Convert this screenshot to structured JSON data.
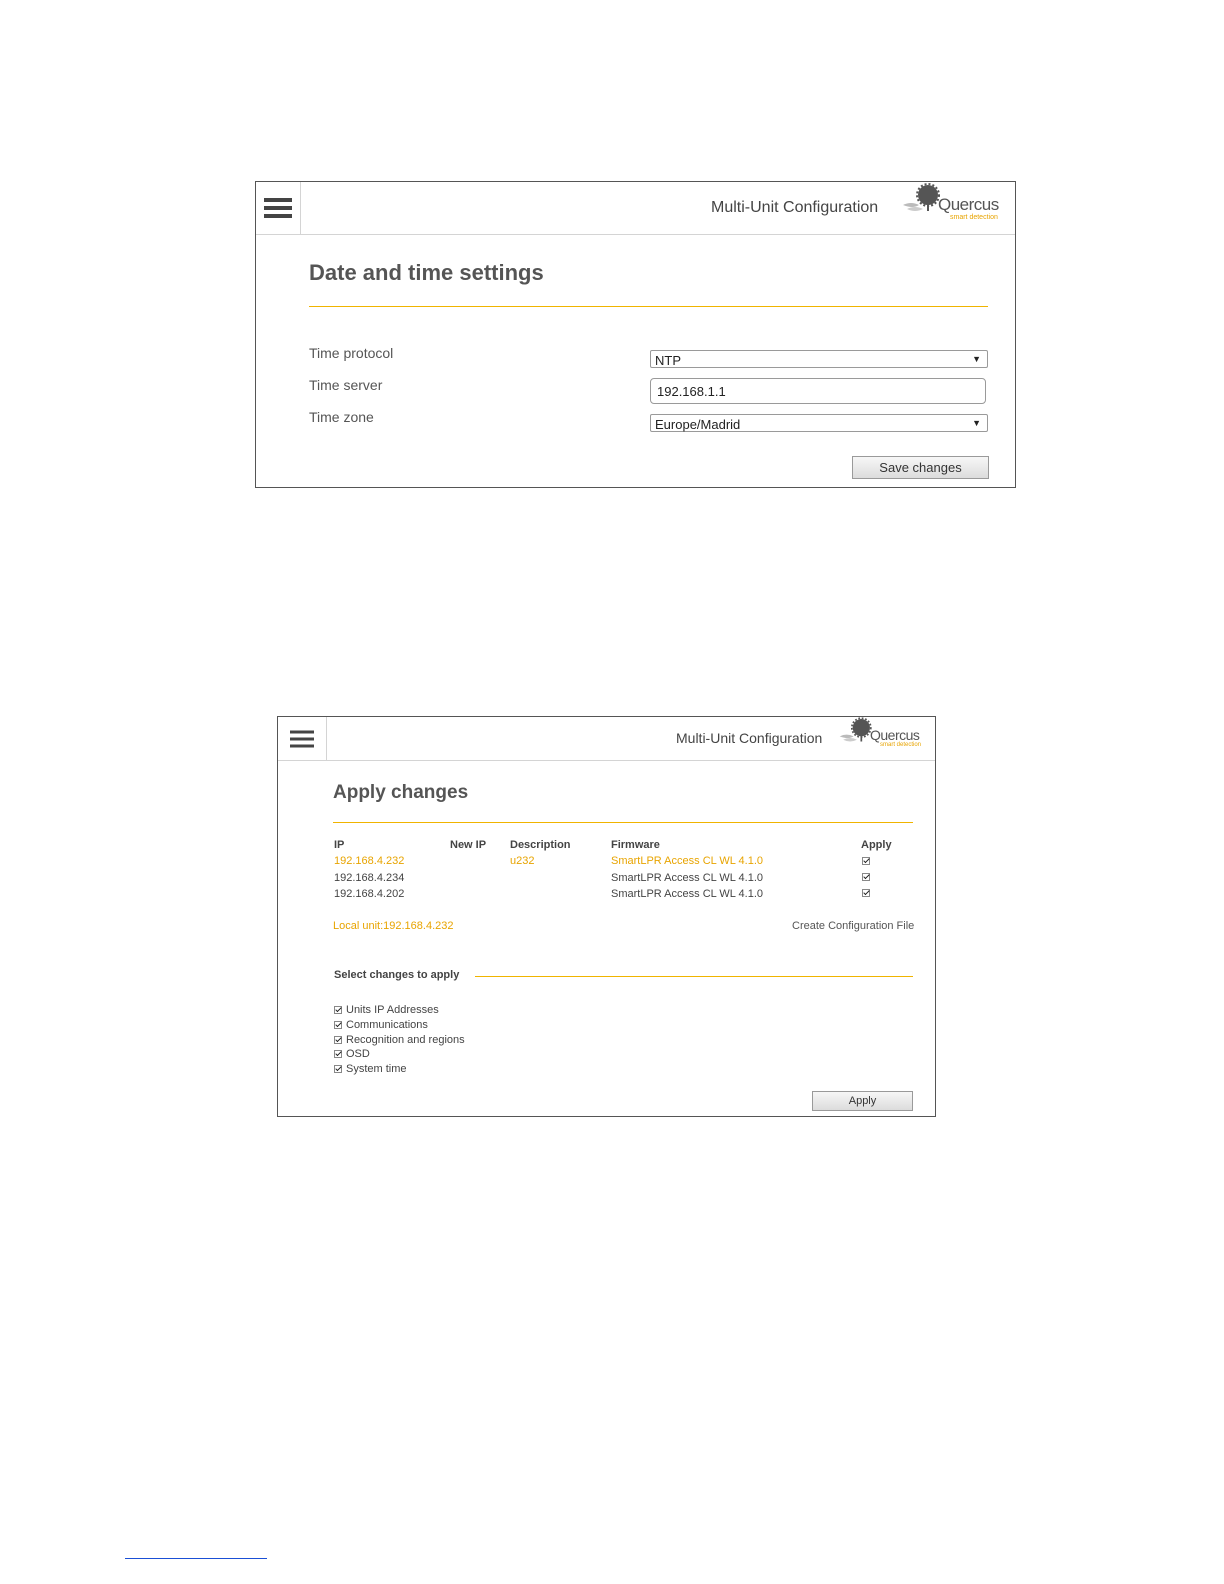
{
  "panel1": {
    "header": {
      "title": "Multi-Unit Configuration",
      "logo_name": "Quercus",
      "logo_tagline": "smart detection"
    },
    "page_title": "Date and time settings",
    "fields": [
      {
        "label": "Time protocol",
        "type": "select",
        "value": "NTP"
      },
      {
        "label": "Time server",
        "type": "text",
        "value": "192.168.1.1"
      },
      {
        "label": "Time zone",
        "type": "select",
        "value": "Europe/Madrid"
      }
    ],
    "save_label": "Save changes"
  },
  "panel2": {
    "header": {
      "title": "Multi-Unit Configuration",
      "logo_name": "Quercus",
      "logo_tagline": "smart detection"
    },
    "page_title": "Apply changes",
    "table": {
      "columns": [
        "IP",
        "New IP",
        "Description",
        "Firmware",
        "Apply"
      ],
      "rows": [
        {
          "ip": "192.168.4.232",
          "new_ip": "",
          "description": "u232",
          "firmware": "SmartLPR Access CL WL 4.1.0",
          "apply": true,
          "highlight": true
        },
        {
          "ip": "192.168.4.234",
          "new_ip": "",
          "description": "",
          "firmware": "SmartLPR Access CL WL 4.1.0",
          "apply": true,
          "highlight": false
        },
        {
          "ip": "192.168.4.202",
          "new_ip": "",
          "description": "",
          "firmware": "SmartLPR Access CL WL 4.1.0",
          "apply": true,
          "highlight": false
        }
      ]
    },
    "local_unit": "Local unit:192.168.4.232",
    "create_config_label": "Create Configuration File",
    "section_title": "Select changes to apply",
    "options": [
      {
        "label": "Units IP Addresses",
        "checked": true
      },
      {
        "label": "Communications",
        "checked": true
      },
      {
        "label": "Recognition and regions",
        "checked": true
      },
      {
        "label": "OSD",
        "checked": true
      },
      {
        "label": "System time",
        "checked": true
      }
    ],
    "apply_label": "Apply"
  },
  "colors": {
    "accent": "#f0b400",
    "highlight_text": "#e8a400",
    "border": "#555555"
  },
  "icons": {
    "menu": "hamburger-icon",
    "logo": "quercus-tree-logo-icon"
  }
}
